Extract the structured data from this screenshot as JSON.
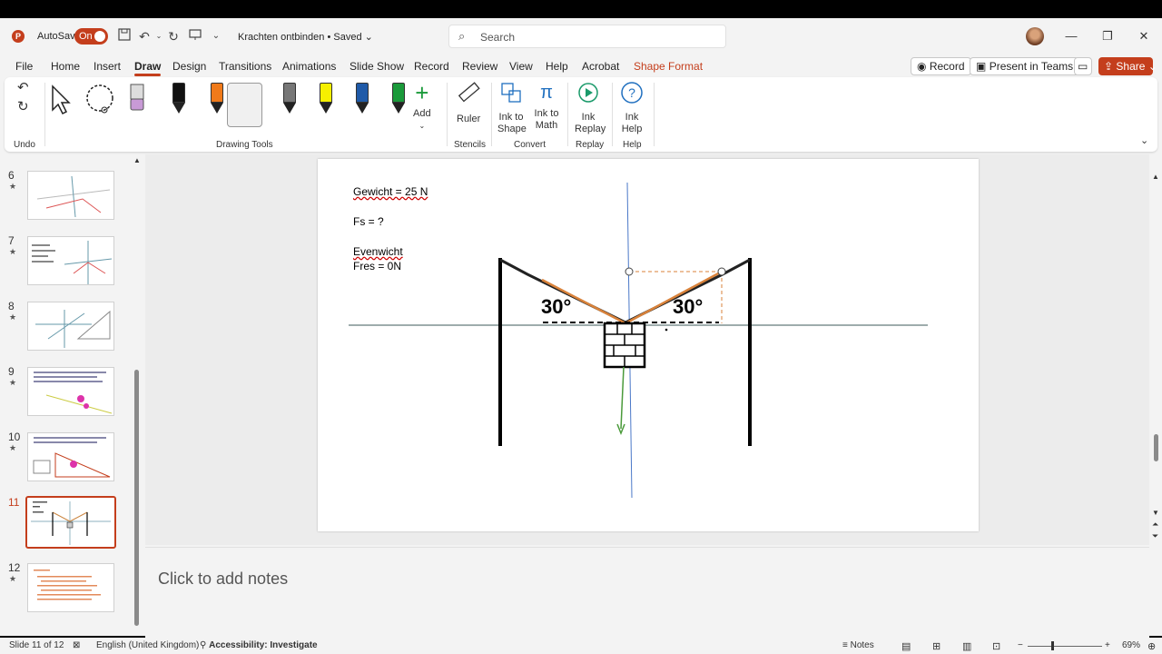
{
  "app": {
    "autosave_label": "AutoSave",
    "autosave_state": "On",
    "document_title": "Krachten ontbinden • Saved",
    "search_placeholder": "Search",
    "accent_color": "#c43e1c"
  },
  "menu": {
    "tabs": [
      "File",
      "Home",
      "Insert",
      "Draw",
      "Design",
      "Transitions",
      "Animations",
      "Slide Show",
      "Record",
      "Review",
      "View",
      "Help",
      "Acrobat",
      "Shape Format"
    ],
    "active_tab": "Draw",
    "record_label": "Record",
    "present_label": "Present in Teams",
    "share_label": "Share"
  },
  "ribbon": {
    "groups": {
      "undo": "Undo",
      "drawing_tools": "Drawing Tools",
      "stencils": "Stencils",
      "convert": "Convert",
      "replay": "Replay",
      "help": "Help"
    },
    "add_label": "Add",
    "ruler_label": "Ruler",
    "ink_to_shape": "Ink to Shape",
    "ink_to_math": "Ink to Math",
    "ink_replay": "Ink Replay",
    "ink_help": "Ink Help",
    "pens": [
      {
        "icon": "pen-gray-icon",
        "color": "#b0b0b0"
      },
      {
        "icon": "pen-black-icon",
        "color": "#111111"
      },
      {
        "icon": "pen-orange-icon",
        "color": "#f07a1a"
      },
      {
        "icon": "pen-galaxy-icon",
        "color": "#4a5d8a"
      },
      {
        "icon": "pencil-gray-icon",
        "color": "#777777"
      },
      {
        "icon": "highlighter-yellow-icon",
        "color": "#f6f000"
      },
      {
        "icon": "pen-blue-icon",
        "color": "#1f5aa8"
      },
      {
        "icon": "pen-green-icon",
        "color": "#1a9a3a"
      }
    ]
  },
  "thumbnails": [
    {
      "num": "6",
      "star": "★"
    },
    {
      "num": "7",
      "star": "★"
    },
    {
      "num": "8",
      "star": "★"
    },
    {
      "num": "9",
      "star": "★"
    },
    {
      "num": "10",
      "star": "★"
    },
    {
      "num": "11",
      "star": "",
      "selected": true
    },
    {
      "num": "12",
      "star": "★"
    }
  ],
  "slide": {
    "line1": "Gewicht = 25 N",
    "line2": "Fs = ?",
    "line3": "Evenwicht",
    "line4": "Fres = 0N",
    "angle_left": "30°",
    "angle_right": "30°"
  },
  "notes_placeholder": "Click to add notes",
  "status": {
    "slide_info": "Slide 11 of 12",
    "language": "English (United Kingdom)",
    "accessibility": "Accessibility: Investigate",
    "notes_label": "Notes",
    "zoom": "69%"
  }
}
